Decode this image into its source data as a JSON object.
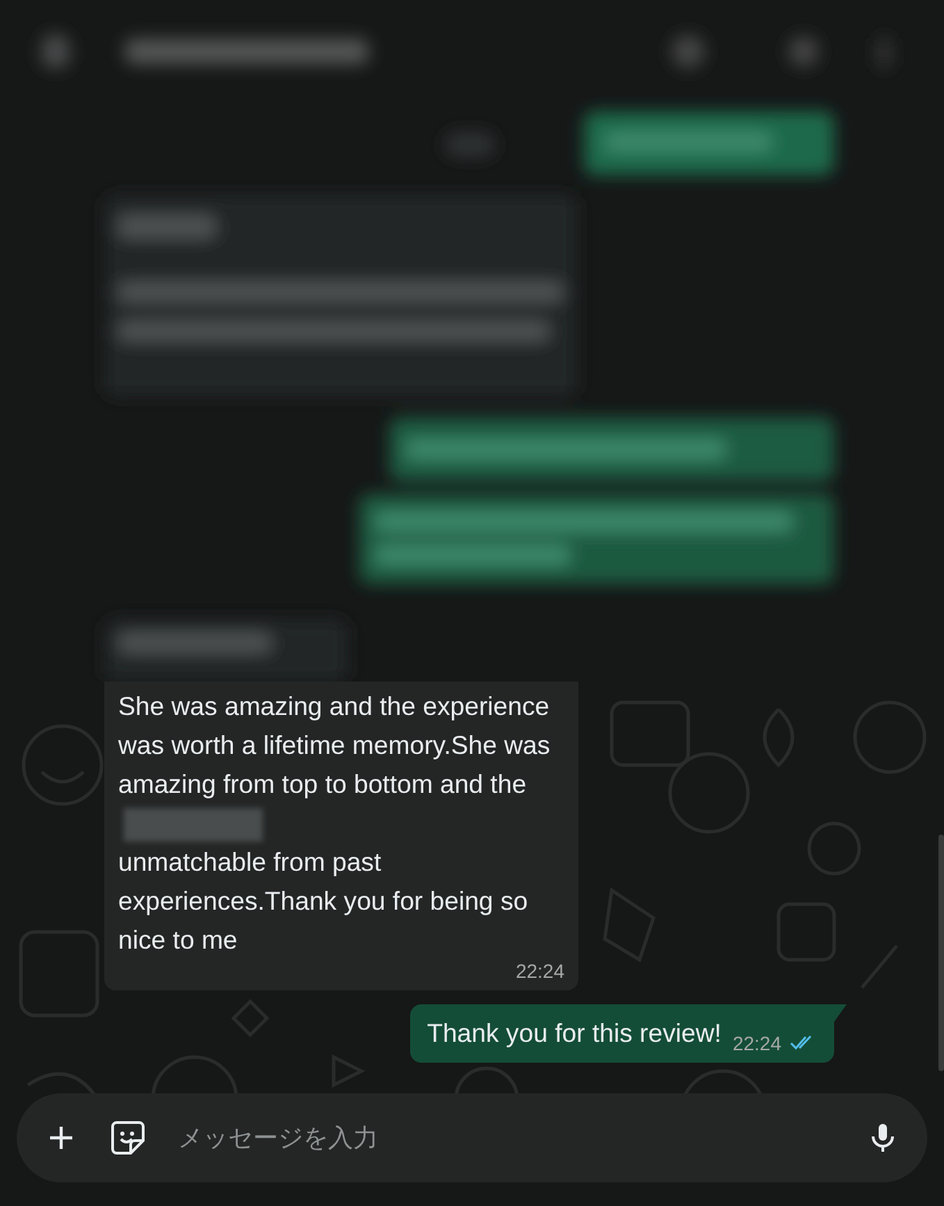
{
  "incoming_message": {
    "text_before": "She was amazing and the experience was worth a lifetime memory.She was amazing from top to bottom and the",
    "text_after": "unmatchable from past experiences.Thank you for being so nice to me",
    "time": "22:24"
  },
  "outgoing_message": {
    "text": "Thank you for this review!",
    "time": "22:24",
    "read": true
  },
  "composer": {
    "placeholder": "メッセージを入力"
  }
}
